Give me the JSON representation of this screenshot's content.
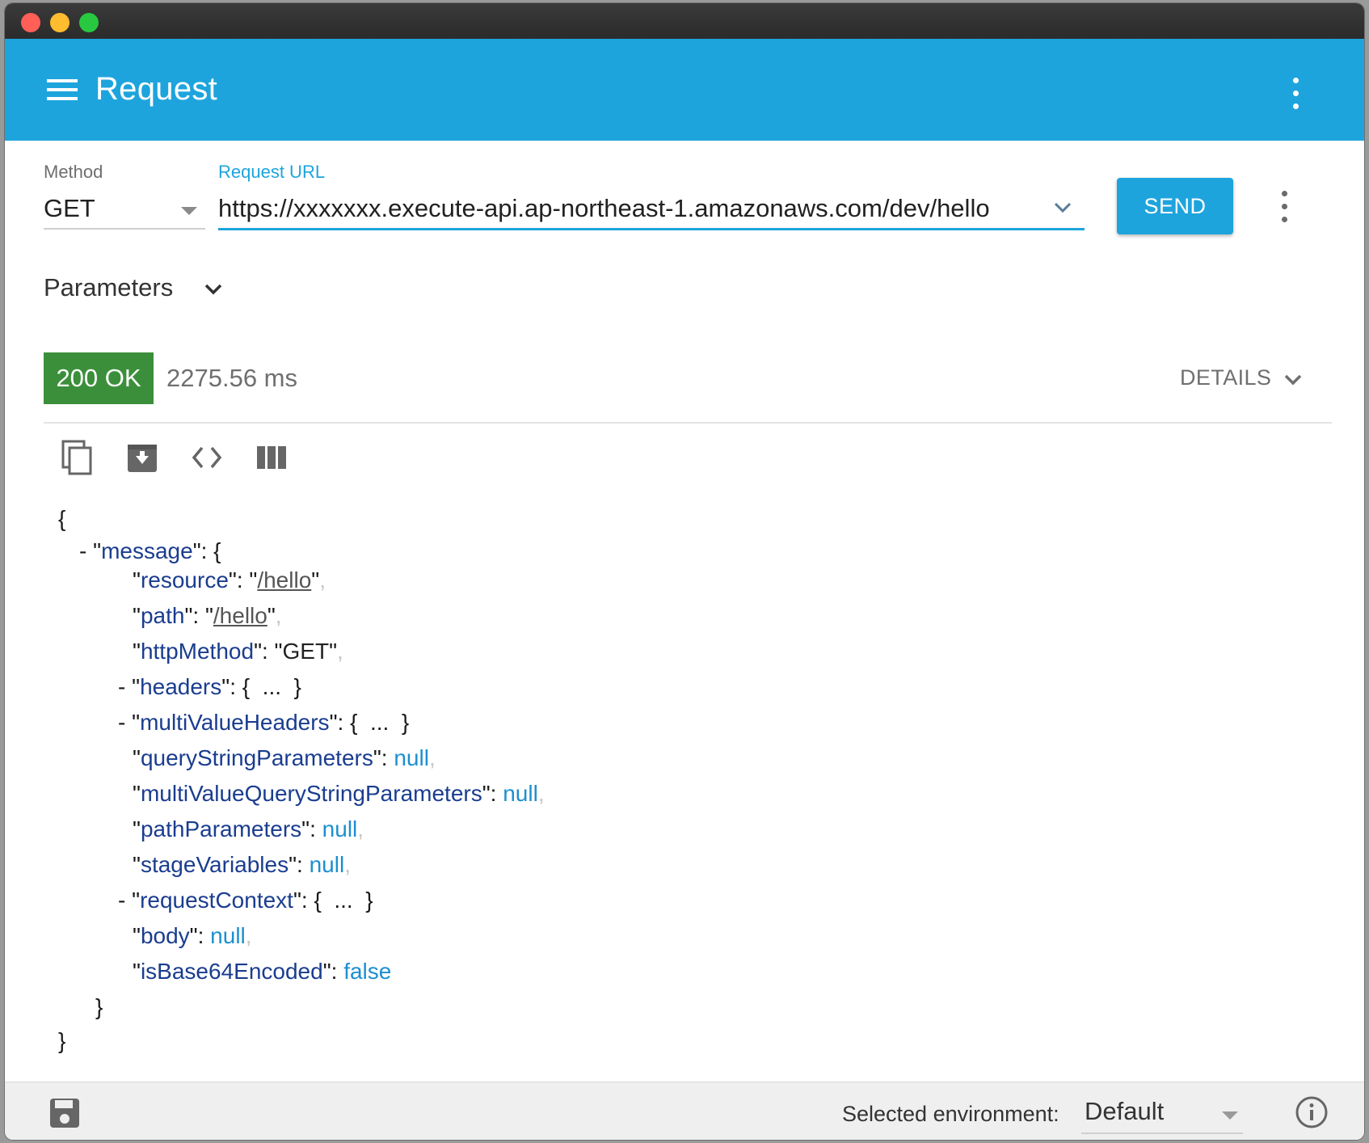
{
  "app": {
    "title": "Request"
  },
  "request": {
    "method_label": "Method",
    "method_value": "GET",
    "url_label": "Request URL",
    "url_value": "https://xxxxxxx.execute-api.ap-northeast-1.amazonaws.com/dev/hello",
    "send_label": "SEND"
  },
  "parameters": {
    "label": "Parameters"
  },
  "response": {
    "status": "200 OK",
    "status_color": "#3b8f3a",
    "time": "2275.56 ms",
    "details_label": "DETAILS"
  },
  "toolbar": {
    "icons": [
      "copy-icon",
      "save-response-icon",
      "code-view-icon",
      "columns-view-icon"
    ]
  },
  "json_view": {
    "open_brace": "{",
    "message_key": "message",
    "fields": [
      {
        "key": "resource",
        "value": "/hello"
      },
      {
        "key": "path",
        "value": "/hello"
      },
      {
        "key": "httpMethod",
        "value": "GET"
      },
      {
        "key": "headers",
        "value": "{  ...  }"
      },
      {
        "key": "multiValueHeaders",
        "value": "{  ...  }"
      },
      {
        "key": "queryStringParameters",
        "value": "null"
      },
      {
        "key": "multiValueQueryStringParameters",
        "value": "null"
      },
      {
        "key": "pathParameters",
        "value": "null"
      },
      {
        "key": "stageVariables",
        "value": "null"
      },
      {
        "key": "requestContext",
        "value": "{  ...  }"
      },
      {
        "key": "body",
        "value": "null"
      },
      {
        "key": "isBase64Encoded",
        "value": "false"
      }
    ],
    "close_inner": "}",
    "close_outer": "}"
  },
  "footer": {
    "env_label": "Selected environment:",
    "env_value": "Default"
  },
  "colors": {
    "accent": "#1ea4dd",
    "success": "#3b8f3a"
  }
}
